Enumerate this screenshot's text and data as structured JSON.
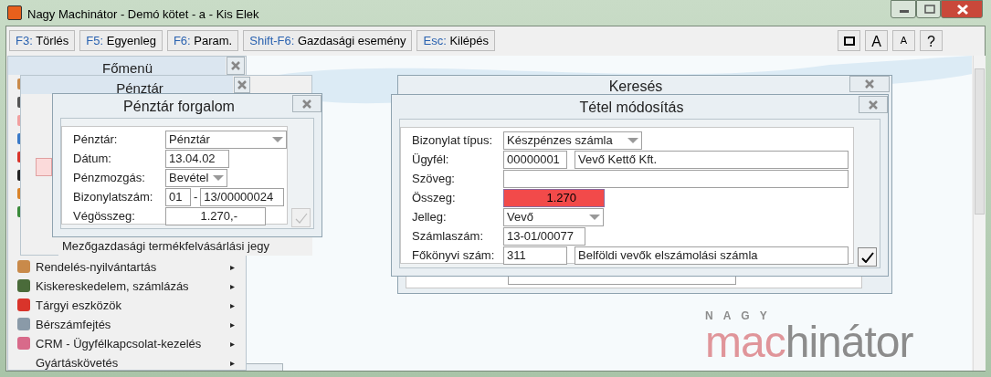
{
  "window": {
    "title": "Nagy Machinátor - Demó kötet - a - Kis Elek"
  },
  "toolbar": [
    {
      "key": "F3:",
      "label": "Törlés"
    },
    {
      "key": "F5:",
      "label": "Egyenleg"
    },
    {
      "key": "F6:",
      "label": "Param."
    },
    {
      "key": "Shift-F6:",
      "label": "Gazdasági esemény"
    },
    {
      "key": "Esc:",
      "label": "Kilépés"
    }
  ],
  "toolbar_right": [
    {
      "kind": "frame"
    },
    {
      "kind": "text",
      "label": "A"
    },
    {
      "kind": "text-small",
      "label": "A"
    },
    {
      "kind": "text",
      "label": "?"
    }
  ],
  "main_menu": {
    "title": "Főmenü",
    "items": [
      {
        "label": "Rendelés-nyilvántartás",
        "arrow": "▸"
      },
      {
        "label": "Kiskereskedelem, számlázás",
        "arrow": "▸"
      },
      {
        "label": "Tárgyi eszközök",
        "arrow": "▸"
      },
      {
        "label": "Bérszámfejtés",
        "arrow": "▸"
      },
      {
        "label": "CRM - Ügyfélkapcsolat-kezelés",
        "arrow": "▸"
      },
      {
        "label": "Gyártáskövetés",
        "arrow": "▸"
      }
    ]
  },
  "cash_menu": {
    "title": "Pénztár",
    "items": [
      "Mezőgazdasági termékfelvásárlási jegy"
    ]
  },
  "cash_dialog": {
    "title": "Pénztár forgalom",
    "fields": [
      {
        "label": "Pénztár:",
        "kind": "select",
        "value": "Pénztár"
      },
      {
        "label": "Dátum:",
        "kind": "text",
        "value": "13.04.02"
      },
      {
        "label": "Pénzmozgás:",
        "kind": "select-short",
        "value": "Bevétel"
      },
      {
        "label": "Bizonylatszám:",
        "kind": "pair",
        "value": "01",
        "separator": "-",
        "value2": "13/00000024"
      },
      {
        "label": "Végösszeg:",
        "kind": "amount",
        "value": "1.270,-"
      }
    ],
    "ok_enabled": false
  },
  "search_dialog": {
    "title": "Keresés"
  },
  "item_dialog": {
    "title": "Tétel módosítás",
    "fields": [
      {
        "label": "Bizonylat típus:",
        "kind": "select",
        "value": "Készpénzes számla"
      },
      {
        "label": "Ügyfél:",
        "kind": "pair",
        "value": "00000001",
        "value2": "Vevő Kettő Kft."
      },
      {
        "label": "Szöveg:",
        "kind": "wide"
      },
      {
        "label": "Összeg:",
        "kind": "amount",
        "value": "1.270",
        "highlighted": true
      },
      {
        "label": "Jelleg:",
        "kind": "select-short",
        "value": "Vevő"
      },
      {
        "label": "Számlaszám:",
        "kind": "text",
        "value": "13-01/00077"
      },
      {
        "label": "Főkönyvi szám:",
        "kind": "pair",
        "value": "311",
        "value2": "Belföldi vevők elszámolási számla"
      }
    ],
    "ok_enabled": true
  },
  "logo": {
    "top": "NAGY",
    "parts": [
      {
        "text": "mac",
        "color": "#e0959a"
      },
      {
        "text": "hinátor",
        "color": "#8c8c8c"
      }
    ]
  }
}
